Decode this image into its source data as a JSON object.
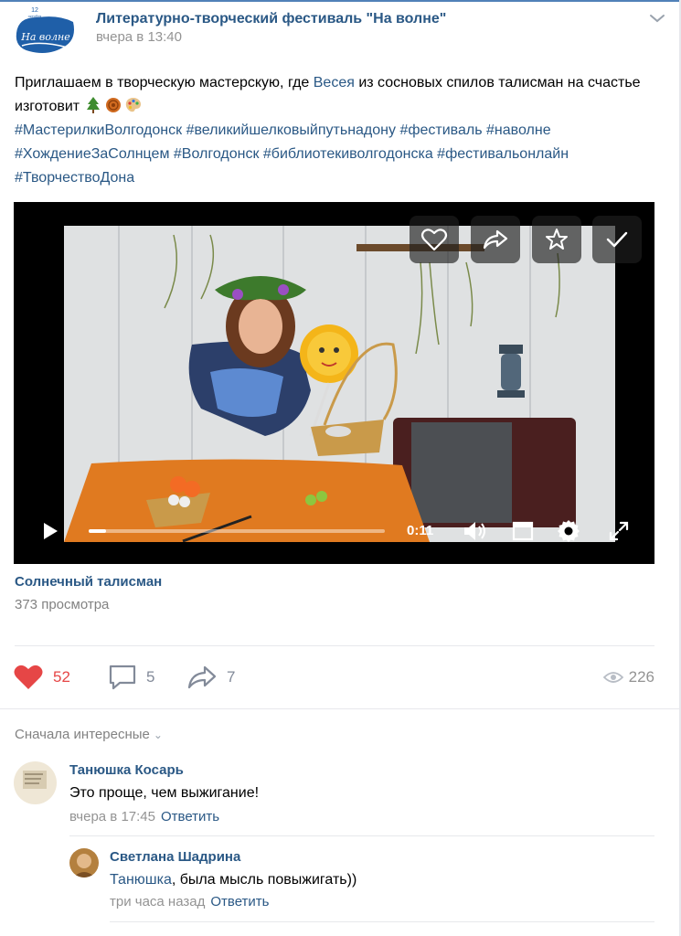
{
  "post": {
    "group_name": "Литературно-творческий фестиваль \"На волне\"",
    "time": "вчера в 13:40",
    "logo_text": "На волне",
    "logo_date_day": "12",
    "logo_date_month": "октября",
    "text_part1": "Приглашаем в творческую мастерскую, где ",
    "mention": "Весея",
    "text_part2": " из сосновых спилов талисман на счастье изготовит ",
    "hashtags": [
      "#МастерилкиВолгодонск",
      "#великийшелковыйпутьнадону",
      "#фестиваль",
      "#наволне",
      "#ХождениеЗаСолнцем",
      "#Волгодонск",
      "#библиотекиволгодонска",
      "#фестивальонлайн",
      "#ТворчествоДона"
    ]
  },
  "video": {
    "title": "Солнечный талисман",
    "views": "373 просмотра",
    "current_time": "0:11",
    "progress": 0.06
  },
  "actions": {
    "likes": "52",
    "comments": "5",
    "shares": "7",
    "views": "226"
  },
  "comments_section": {
    "sort_label": "Сначала интересные",
    "comments": [
      {
        "author": "Танюшка Косарь",
        "text": "Это проще, чем выжигание!",
        "time": "вчера в 17:45",
        "reply_label": "Ответить"
      },
      {
        "author": "Светлана Шадрина",
        "text_mention": "Танюшка",
        "text_rest": ", была мысль повыжигать))",
        "time": "три часа назад",
        "reply_label": "Ответить"
      }
    ]
  },
  "colors": {
    "link": "#2a5885",
    "like": "#e64646",
    "muted": "#939393",
    "accent": "#5181b8"
  }
}
